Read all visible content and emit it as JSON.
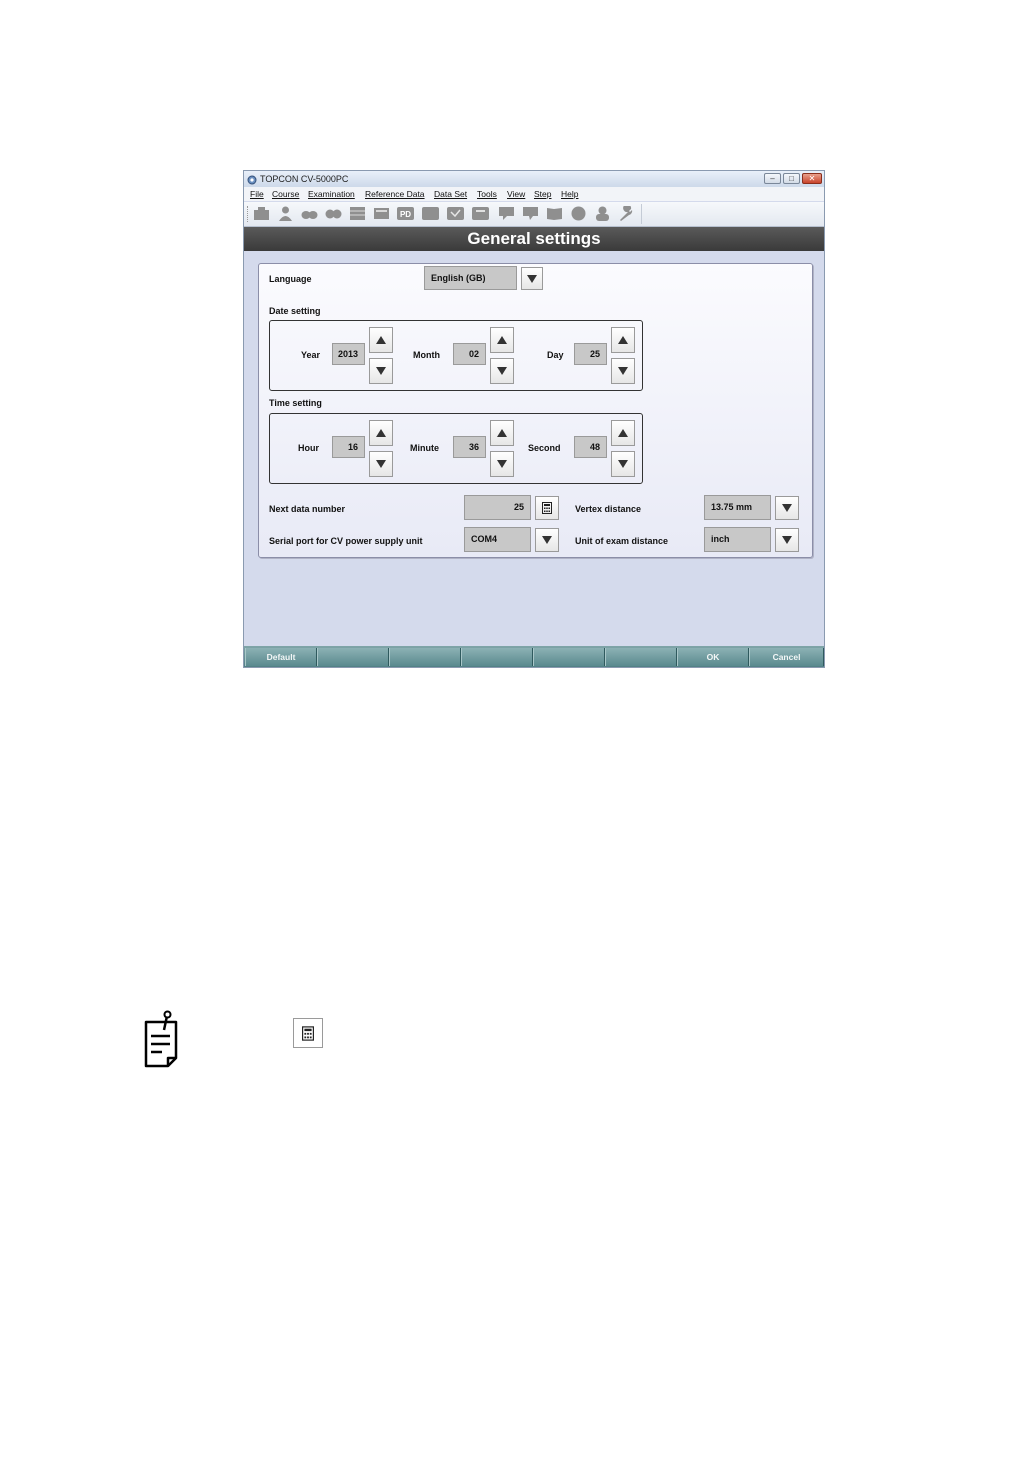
{
  "window": {
    "title": "TOPCON CV-5000PC"
  },
  "menu": [
    {
      "label": "File"
    },
    {
      "label": "Course"
    },
    {
      "label": "Examination"
    },
    {
      "label": "Reference Data"
    },
    {
      "label": "Data Set"
    },
    {
      "label": "Tools"
    },
    {
      "label": "View"
    },
    {
      "label": "Step"
    },
    {
      "label": "Help"
    }
  ],
  "toolbar": {
    "pd_label": "PD",
    "icons": [
      "case-icon",
      "patient-icon",
      "glasses-icon",
      "glasses-icon-2",
      "data-table-icon",
      "card-icon",
      "pd-icon",
      "blank-icon",
      "chart-va-icon",
      "print-icon",
      "speech-bubble-icon",
      "speech-bubble-icon-2",
      "book-icon",
      "circle-icon",
      "user-icon",
      "wrench-icon"
    ]
  },
  "header": {
    "title": "General settings"
  },
  "settings": {
    "language": {
      "label": "Language",
      "value": "English (GB)"
    },
    "date": {
      "label": "Date setting",
      "year_label": "Year",
      "year": "2013",
      "month_label": "Month",
      "month": "02",
      "day_label": "Day",
      "day": "25"
    },
    "time": {
      "label": "Time setting",
      "hour_label": "Hour",
      "hour": "16",
      "minute_label": "Minute",
      "minute": "36",
      "second_label": "Second",
      "second": "48"
    },
    "next_data_number": {
      "label": "Next data number",
      "value": "25"
    },
    "serial_port": {
      "label": "Serial port for CV power supply unit",
      "value": "COM4"
    },
    "vertex_distance": {
      "label": "Vertex distance",
      "value": "13.75 mm"
    },
    "exam_distance_unit": {
      "label": "Unit of exam distance",
      "value": "inch"
    }
  },
  "bottom_bar": {
    "default": "Default",
    "ok": "OK",
    "cancel": "Cancel"
  }
}
